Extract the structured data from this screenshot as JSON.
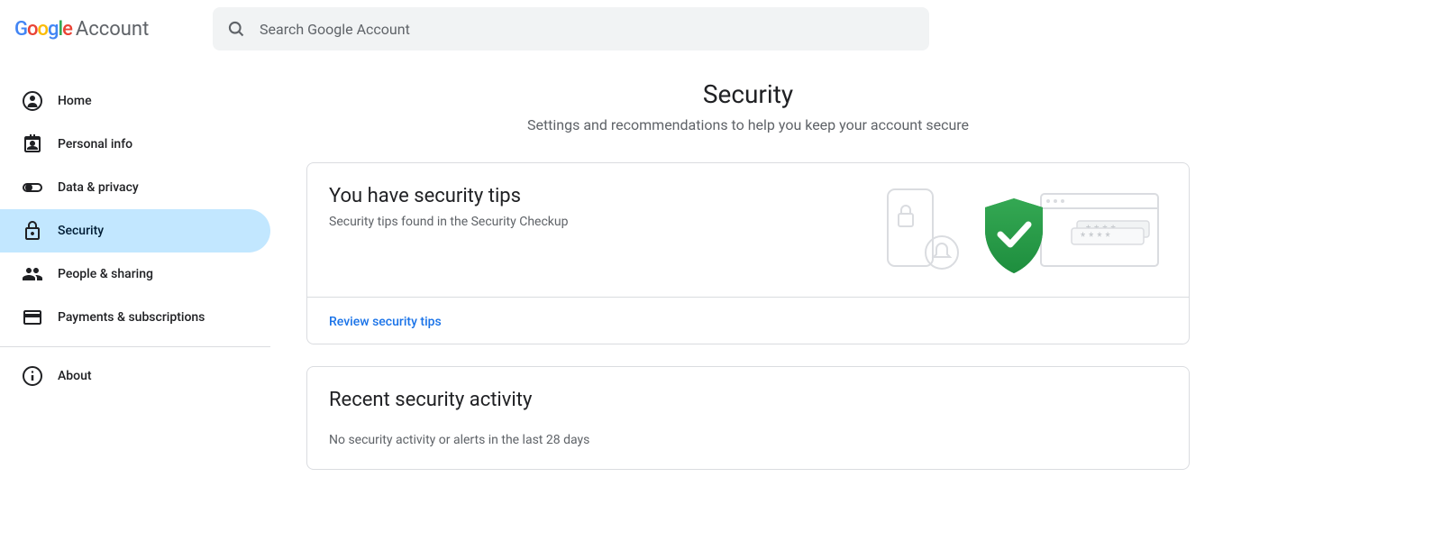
{
  "header": {
    "logo_brand": "Google",
    "logo_product": "Account",
    "search_placeholder": "Search Google Account"
  },
  "sidebar": {
    "items": [
      {
        "label": "Home",
        "icon": "home",
        "active": false
      },
      {
        "label": "Personal info",
        "icon": "personal-info",
        "active": false
      },
      {
        "label": "Data & privacy",
        "icon": "data-privacy",
        "active": false
      },
      {
        "label": "Security",
        "icon": "security",
        "active": true
      },
      {
        "label": "People & sharing",
        "icon": "people-sharing",
        "active": false
      },
      {
        "label": "Payments & subscriptions",
        "icon": "payments",
        "active": false
      }
    ],
    "about_label": "About"
  },
  "main": {
    "title": "Security",
    "subtitle": "Settings and recommendations to help you keep your account secure",
    "tips_card": {
      "title": "You have security tips",
      "description": "Security tips found in the Security Checkup",
      "action_label": "Review security tips"
    },
    "activity_card": {
      "title": "Recent security activity",
      "description": "No security activity or alerts in the last 28 days"
    }
  }
}
